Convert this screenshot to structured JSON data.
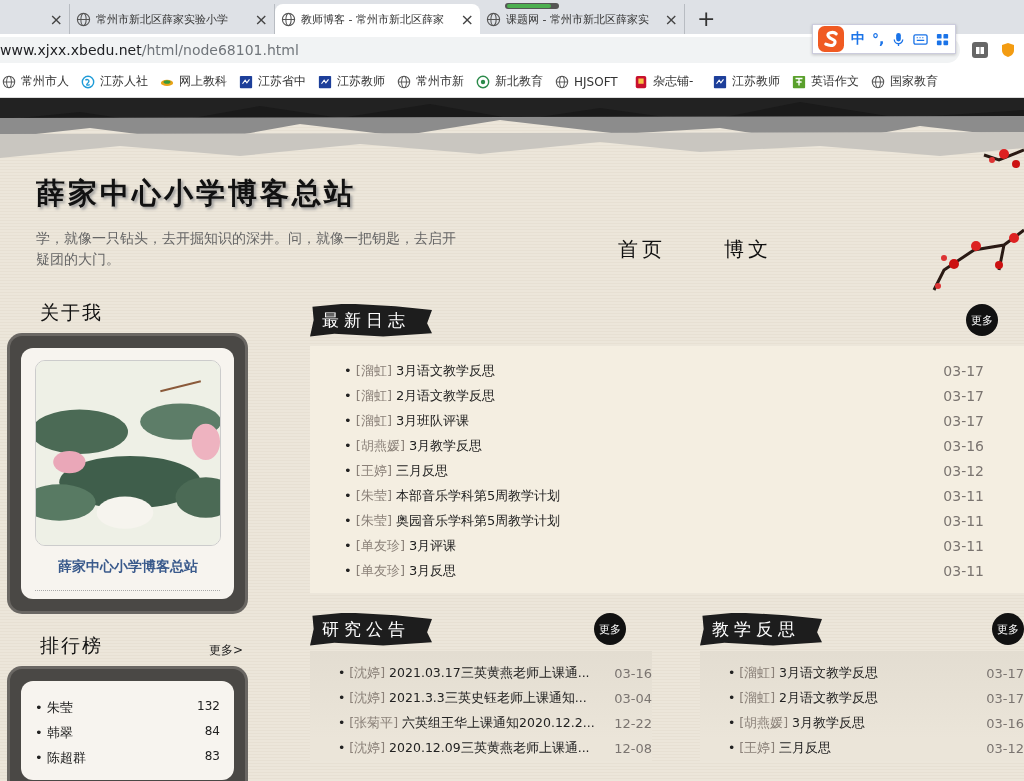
{
  "browser": {
    "tabs": [
      {
        "close": "×",
        "selected": false
      },
      {
        "title": "常州市新北区薛家实验小学",
        "close": "×",
        "selected": false
      },
      {
        "title": "教师博客 - 常州市新北区薛家",
        "close": "×",
        "selected": true
      },
      {
        "title": "课题网 - 常州市新北区薛家实",
        "close": "×",
        "selected": false
      }
    ],
    "new_tab": "+",
    "address": {
      "domain": "www.xjxx.xbedu.net",
      "path": "/html/node68101.html"
    },
    "ime": {
      "mode": "中",
      "punct": "°,"
    },
    "bookmarks": [
      {
        "label": "常州市人",
        "kind": "globe"
      },
      {
        "label": "江苏人社",
        "kind": "swirl"
      },
      {
        "label": "网上教科",
        "kind": "leaf"
      },
      {
        "label": "江苏省中",
        "kind": "square"
      },
      {
        "label": "江苏教师",
        "kind": "square"
      },
      {
        "label": "常州市新",
        "kind": "globe"
      },
      {
        "label": "新北教育",
        "kind": "seal"
      },
      {
        "label": "HJSOFT",
        "kind": "globe"
      },
      {
        "label": "杂志铺-",
        "kind": "red"
      },
      {
        "label": "江苏教师",
        "kind": "square"
      },
      {
        "label": "英语作文",
        "kind": "green"
      },
      {
        "label": "国家教育",
        "kind": "globe"
      }
    ]
  },
  "site": {
    "title": "薛家中心小学博客总站",
    "motto": "学，就像一只钻头，去开掘知识的深井。问，就像一把钥匙，去启开疑团的大门。",
    "nav": [
      {
        "label": "首页"
      },
      {
        "label": "博文"
      }
    ]
  },
  "about": {
    "heading": "关于我",
    "name": "薛家中心小学博客总站"
  },
  "ranking": {
    "heading": "排行榜",
    "more": "更多>",
    "items": [
      {
        "bullet": "•",
        "name": "朱莹",
        "count": "132"
      },
      {
        "bullet": "•",
        "name": "韩翠",
        "count": "84"
      },
      {
        "bullet": "•",
        "name": "陈超群",
        "count": "83"
      }
    ]
  },
  "latest": {
    "heading": "最新日志",
    "more": "更多",
    "rows": [
      {
        "bullet": "•",
        "author": "[溜虹]",
        "title": "3月语文教学反思",
        "date": "03-17"
      },
      {
        "bullet": "•",
        "author": "[溜虹]",
        "title": "2月语文教学反思",
        "date": "03-17"
      },
      {
        "bullet": "•",
        "author": "[溜虹]",
        "title": "3月班队评课",
        "date": "03-17"
      },
      {
        "bullet": "•",
        "author": "[胡燕媛]",
        "title": "3月教学反思",
        "date": "03-16"
      },
      {
        "bullet": "•",
        "author": "[王婷]",
        "title": "三月反思",
        "date": "03-12"
      },
      {
        "bullet": "•",
        "author": "[朱莹]",
        "title": "本部音乐学科第5周教学计划",
        "date": "03-11"
      },
      {
        "bullet": "•",
        "author": "[朱莹]",
        "title": "奥园音乐学科第5周教学计划",
        "date": "03-11"
      },
      {
        "bullet": "•",
        "author": "[单友珍]",
        "title": "3月评课",
        "date": "03-11"
      },
      {
        "bullet": "•",
        "author": "[单友珍]",
        "title": "3月反思",
        "date": "03-11"
      }
    ]
  },
  "research": {
    "heading": "研究公告",
    "more": "更多",
    "rows": [
      {
        "bullet": "•",
        "author": "[沈婷]",
        "title": "2021.03.17三英黄燕老师上课通...",
        "date": "03-16"
      },
      {
        "bullet": "•",
        "author": "[沈婷]",
        "title": "2021.3.3三英史钰老师上课通知...",
        "date": "03-04"
      },
      {
        "bullet": "•",
        "author": "[张菊平]",
        "title": "六英组王华上课通知2020.12.2...",
        "date": "12-22"
      },
      {
        "bullet": "•",
        "author": "[沈婷]",
        "title": "2020.12.09三英黄燕老师上课通...",
        "date": "12-08"
      }
    ]
  },
  "reflection": {
    "heading": "教学反思",
    "more": "更多",
    "rows": [
      {
        "bullet": "•",
        "author": "[溜虹]",
        "title": "3月语文教学反思",
        "date": "03-17"
      },
      {
        "bullet": "•",
        "author": "[溜虹]",
        "title": "2月语文教学反思",
        "date": "03-17"
      },
      {
        "bullet": "•",
        "author": "[胡燕媛]",
        "title": "3月教学反思",
        "date": "03-16"
      },
      {
        "bullet": "•",
        "author": "[王婷]",
        "title": "三月反思",
        "date": "03-12"
      }
    ]
  }
}
